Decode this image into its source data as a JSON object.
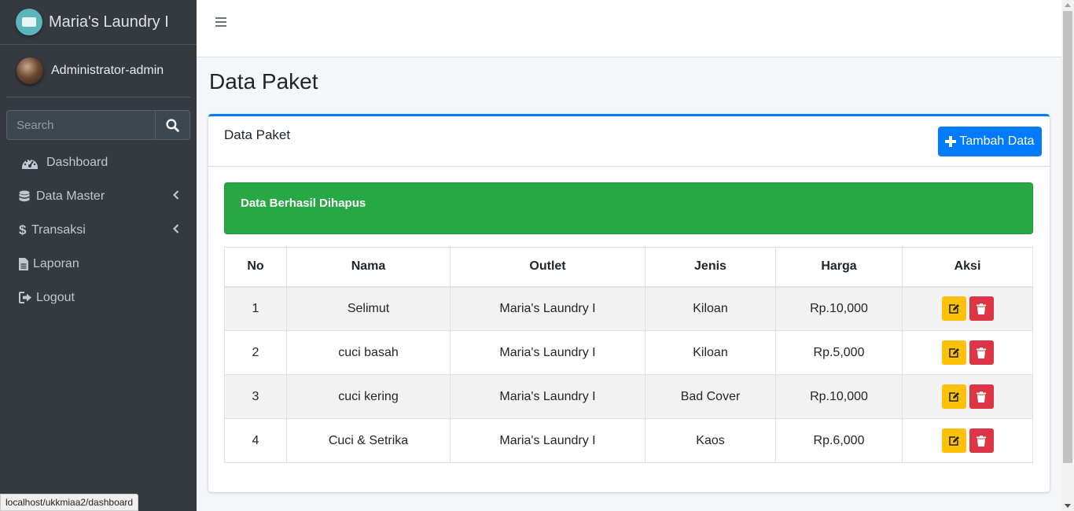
{
  "sidebar": {
    "brand": "Maria's Laundry I",
    "user": "Administrator-admin",
    "search_placeholder": "Search",
    "nav": [
      {
        "label": "Dashboard",
        "icon": "tachometer-icon"
      },
      {
        "label": "Data Master",
        "icon": "database-icon"
      },
      {
        "label": "Transaksi",
        "icon": "dollar-icon"
      },
      {
        "label": "Laporan",
        "icon": "file-icon"
      },
      {
        "label": "Logout",
        "icon": "sign-out-icon"
      }
    ]
  },
  "page": {
    "title": "Data Paket"
  },
  "card": {
    "title": "Data Paket",
    "add_button": "Tambah Data",
    "alert": "Data Berhasil Dihapus"
  },
  "table": {
    "headers": [
      "No",
      "Nama",
      "Outlet",
      "Jenis",
      "Harga",
      "Aksi"
    ],
    "rows": [
      {
        "no": "1",
        "nama": "Selimut",
        "outlet": "Maria's Laundry I",
        "jenis": "Kiloan",
        "harga": "Rp.10,000"
      },
      {
        "no": "2",
        "nama": "cuci basah",
        "outlet": "Maria's Laundry I",
        "jenis": "Kiloan",
        "harga": "Rp.5,000"
      },
      {
        "no": "3",
        "nama": "cuci kering",
        "outlet": "Maria's Laundry I",
        "jenis": "Bad Cover",
        "harga": "Rp.10,000"
      },
      {
        "no": "4",
        "nama": "Cuci & Setrika",
        "outlet": "Maria's Laundry I",
        "jenis": "Kaos",
        "harga": "Rp.6,000"
      }
    ]
  },
  "statusbar": {
    "url": "localhost/ukkmiaa2/dashboard"
  },
  "colors": {
    "sidebar_bg": "#343a40",
    "primary": "#007bff",
    "success": "#28a745",
    "warning": "#ffc107",
    "danger": "#dc3545"
  }
}
